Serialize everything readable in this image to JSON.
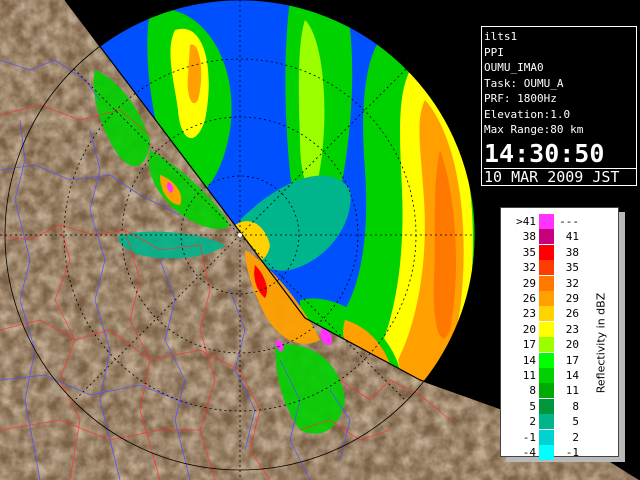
{
  "info": {
    "radar_name": "ilts1",
    "scan_type": "PPI",
    "site": "OUMU_IMA0",
    "task": "Task: OUMU_A",
    "prf": "PRF: 1800Hz",
    "elevation": "Elevation:1.0",
    "max_range": "Max Range:80 km",
    "time": "14:30:50",
    "date": "10 MAR 2009 JST"
  },
  "legend": {
    "title": "Reflectivity in dBZ",
    "rows": [
      {
        "lo": ">41",
        "hi": "---",
        "color": "#ff32ff"
      },
      {
        "lo": "38",
        "hi": "41",
        "color": "#c8007d"
      },
      {
        "lo": "35",
        "hi": "38",
        "color": "#ff0000"
      },
      {
        "lo": "32",
        "hi": "35",
        "color": "#ff3c00"
      },
      {
        "lo": "29",
        "hi": "32",
        "color": "#ff7800"
      },
      {
        "lo": "26",
        "hi": "29",
        "color": "#ffa000"
      },
      {
        "lo": "23",
        "hi": "26",
        "color": "#ffd200"
      },
      {
        "lo": "20",
        "hi": "23",
        "color": "#ffff00"
      },
      {
        "lo": "17",
        "hi": "20",
        "color": "#9bff00"
      },
      {
        "lo": "14",
        "hi": "17",
        "color": "#00ff00"
      },
      {
        "lo": "11",
        "hi": "14",
        "color": "#00d200"
      },
      {
        "lo": "8",
        "hi": "11",
        "color": "#00aa00"
      },
      {
        "lo": "5",
        "hi": "8",
        "color": "#00963c"
      },
      {
        "lo": "2",
        "hi": "5",
        "color": "#00b48c"
      },
      {
        "lo": "-1",
        "hi": "2",
        "color": "#00d2d2"
      },
      {
        "lo": "-4",
        "hi": "-1",
        "color": "#00ffff"
      }
    ]
  },
  "colors": {
    "no_echo": "#0050ff",
    "land": "#8c7050",
    "border": "#ff3030",
    "river": "#5050ff",
    "coast": "#000000",
    "grid": "#000000"
  }
}
